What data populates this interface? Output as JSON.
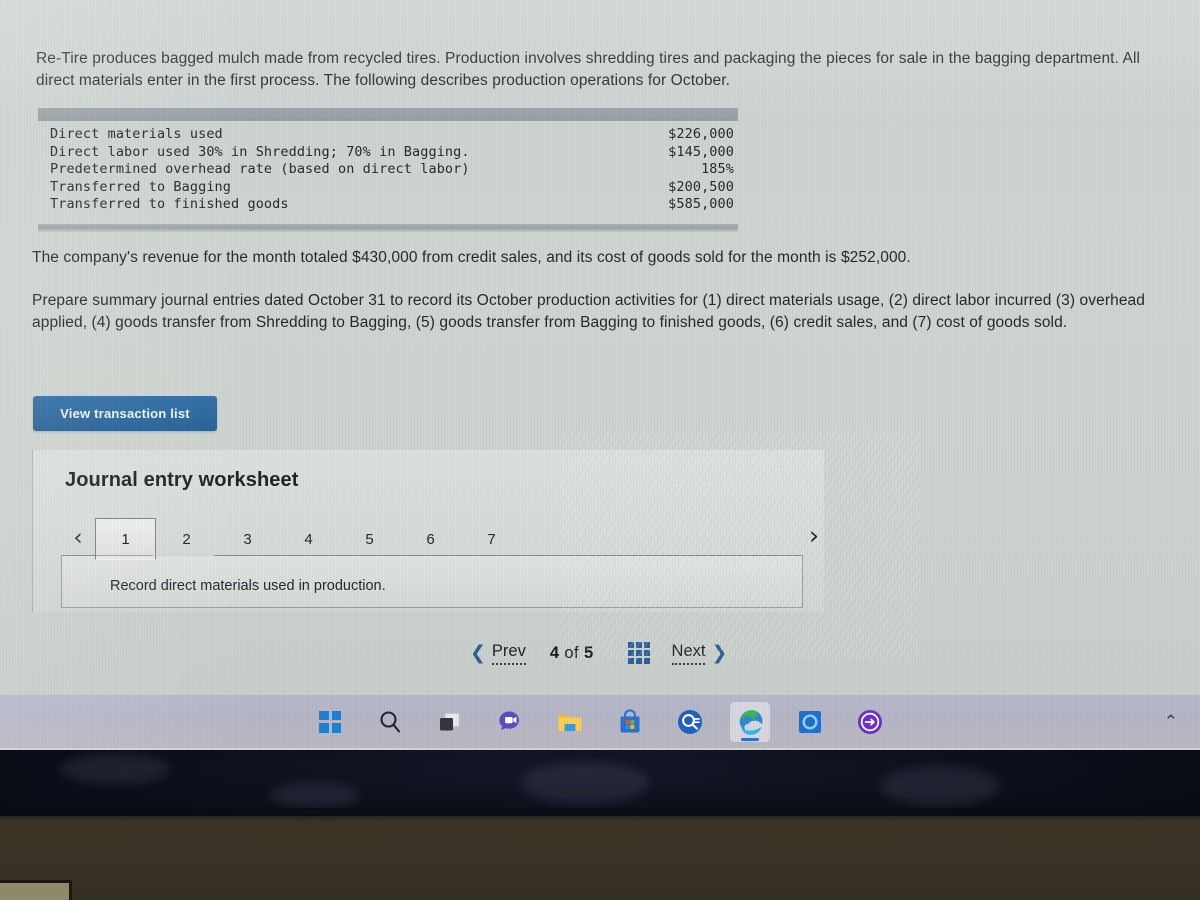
{
  "problem": {
    "intro": "Re-Tire produces bagged mulch made from recycled tires. Production involves shredding tires and packaging the pieces for sale in the bagging department. All direct materials enter in the first process. The following describes production operations for October.",
    "table": {
      "rows": [
        {
          "label": "Direct materials used",
          "value": "$226,000"
        },
        {
          "label": "Direct labor used 30% in Shredding; 70% in Bagging.",
          "value": "$145,000"
        },
        {
          "label": "Predetermined overhead rate (based on direct labor)",
          "value": "185%"
        },
        {
          "label": "Transferred to Bagging",
          "value": "$200,500"
        },
        {
          "label": "Transferred to finished goods",
          "value": "$585,000"
        }
      ]
    },
    "revenue_paragraph": "The company's revenue for the month totaled $430,000 from credit sales, and its cost of goods sold for the month is $252,000.",
    "instructions_paragraph": "Prepare summary journal entries dated October 31 to record its October production activities for (1) direct materials usage, (2) direct labor incurred (3) overhead applied, (4) goods transfer from Shredding to Bagging, (5) goods transfer from  Bagging to finished goods, (6) credit sales, and (7) cost of goods sold."
  },
  "view_transaction_button": {
    "label": "View transaction list"
  },
  "worksheet": {
    "title": "Journal entry worksheet",
    "prev_arrow": "‹",
    "next_arrow": "›",
    "tabs": [
      {
        "label": "1",
        "active": true
      },
      {
        "label": "2",
        "active": false
      },
      {
        "label": "3",
        "active": false
      },
      {
        "label": "4",
        "active": false
      },
      {
        "label": "5",
        "active": false
      },
      {
        "label": "6",
        "active": false
      },
      {
        "label": "7",
        "active": false
      }
    ],
    "panel_text": "Record direct materials used in production."
  },
  "pager": {
    "prev_chevron": "❮",
    "prev_label": "Prev",
    "current_page": "4",
    "of_word": "of",
    "total_pages": "5",
    "grid_icon": "grid-icon",
    "next_label": "Next",
    "next_chevron": "❯"
  },
  "taskbar": {
    "items": [
      {
        "name": "start-button",
        "icon": "windows-logo-icon",
        "active": false
      },
      {
        "name": "search-button",
        "icon": "search-icon",
        "active": false
      },
      {
        "name": "task-view-button",
        "icon": "task-view-icon",
        "active": false
      },
      {
        "name": "chat-button",
        "icon": "chat-video-icon",
        "active": false
      },
      {
        "name": "file-explorer-button",
        "icon": "folder-icon",
        "active": false
      },
      {
        "name": "microsoft-store-button",
        "icon": "store-bag-icon",
        "active": false
      },
      {
        "name": "search-circle-button",
        "icon": "blue-circle-search-icon",
        "active": false
      },
      {
        "name": "edge-button",
        "icon": "edge-browser-icon",
        "active": true
      },
      {
        "name": "cortana-button",
        "icon": "blue-ring-icon",
        "active": false
      },
      {
        "name": "purple-app-button",
        "icon": "purple-arrow-circle-icon",
        "active": false
      }
    ],
    "tray_chevron": "⌃"
  },
  "colors": {
    "accent_blue": "#2c5f96",
    "button_blue": "#2a679e",
    "table_bar_gray": "#9aa3a7",
    "page_bg": "#ccd2ce",
    "taskbar_bg": "#b6b7c7"
  }
}
